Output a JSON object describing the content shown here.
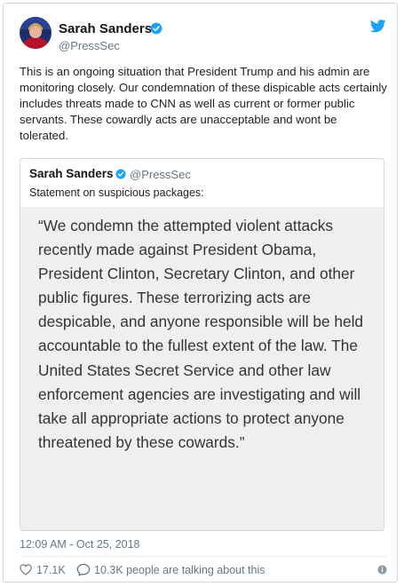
{
  "author": {
    "name": "Sarah Sanders",
    "handle": "@PressSec"
  },
  "tweet_text": "This is an ongoing situation that President Trump and his admin are monitoring closely. Our condemnation of these dispicable acts certainly includes threats made to CNN as well as current or former public servants. These cowardly acts are unacceptable and wont be tolerated.",
  "quoted": {
    "name": "Sarah Sanders",
    "handle": "@PressSec",
    "text": "Statement on suspicious packages:",
    "image_text": "“We condemn the attempted violent attacks recently made against President Obama, President Clinton, Secretary Clinton, and other public figures. These terrorizing acts are despicable, and anyone responsible will be held accountable to the fullest extent of the law. The United States Secret Service and other law enforcement agencies are investigating and will take all appropriate actions to protect anyone threatened by these cowards.”"
  },
  "timestamp": "12:09 AM - Oct 25, 2018",
  "likes": "17.1K",
  "replies": "10.3K people are talking about this",
  "icons": {
    "verified": "verified-badge-icon",
    "bird": "twitter-bird-icon",
    "heart": "heart-icon",
    "bubble": "reply-bubble-icon",
    "info": "info-icon"
  },
  "colors": {
    "brand_blue": "#1da1f2",
    "text": "#1c2022",
    "muted": "#657786",
    "quote_image_bg": "#efefef"
  }
}
